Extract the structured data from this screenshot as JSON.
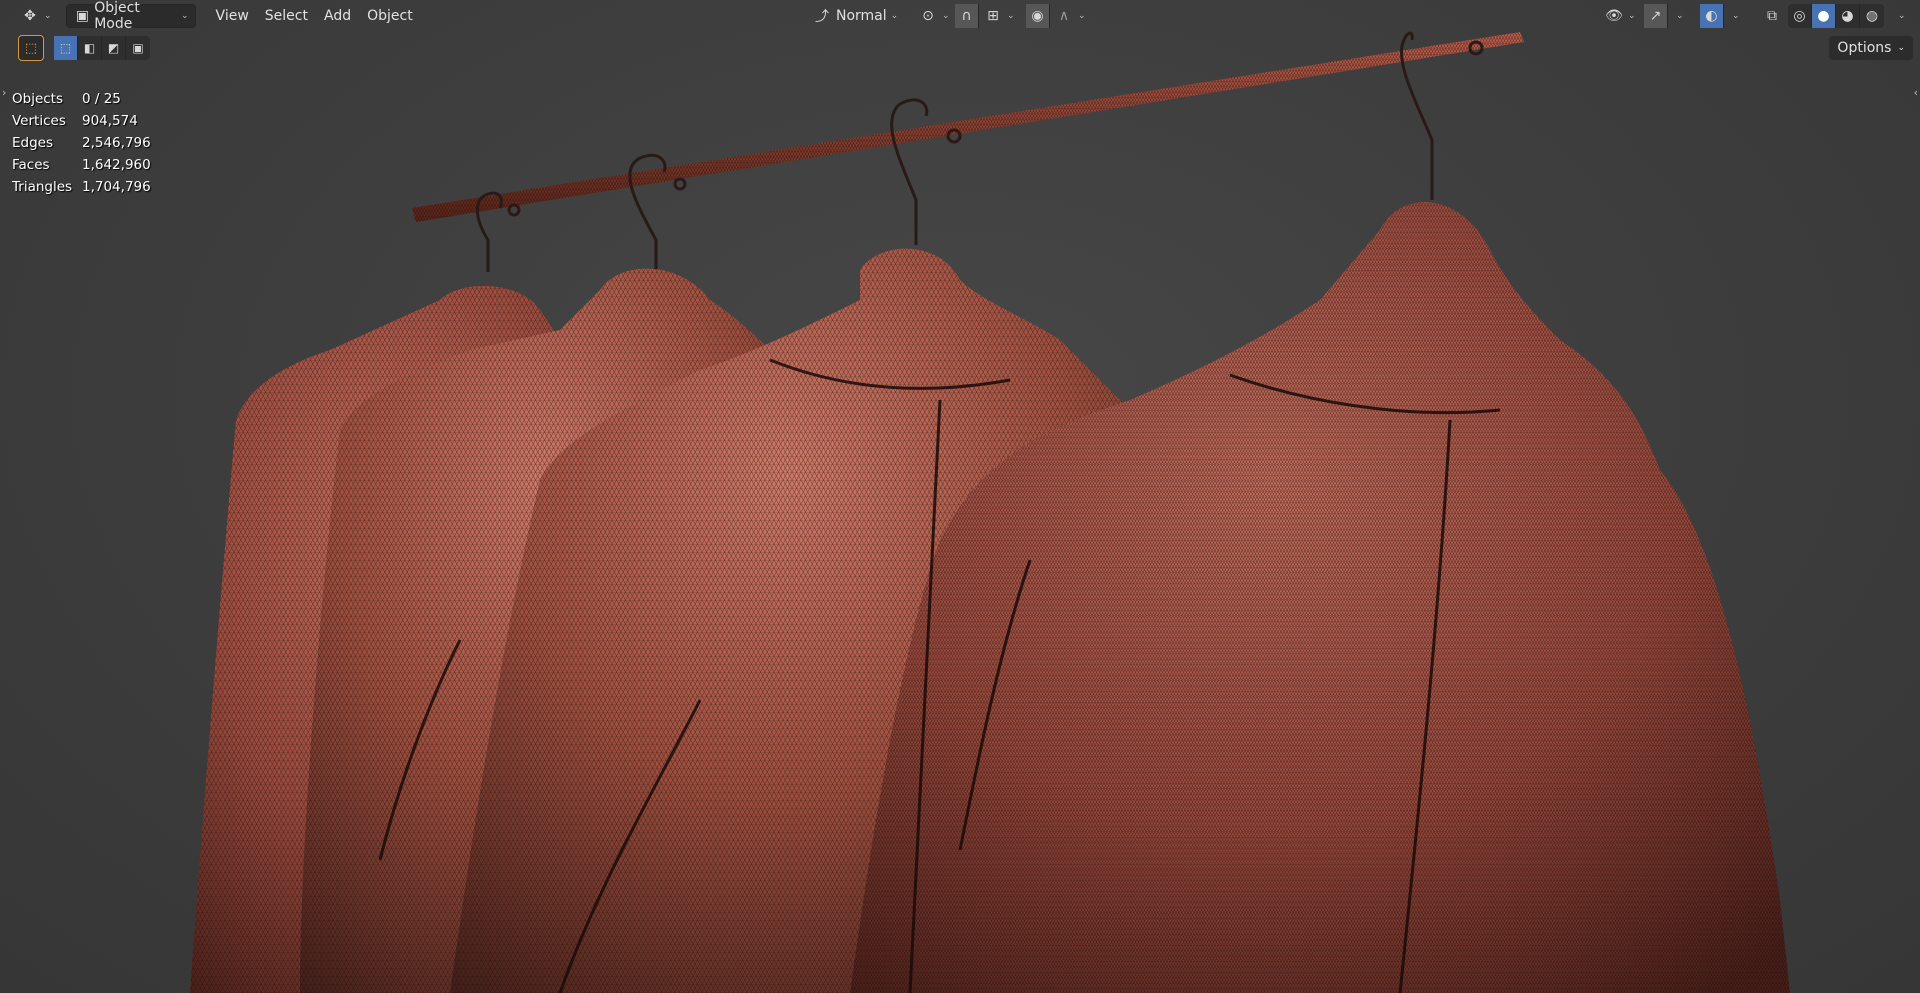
{
  "header": {
    "editor_type_icon": "move-gizmo-icon",
    "mode": "Object Mode",
    "menus": [
      "View",
      "Select",
      "Add",
      "Object"
    ],
    "transform_orientation": "Normal",
    "pivot_icon": "pivot-icon",
    "snap_icon": "magnet-icon",
    "snap_target_icon": "snap-increment-icon",
    "proportional_icon": "proportional-edit-icon",
    "falloff_icon": "falloff-curve-icon",
    "visibility_icon": "eye-icon",
    "gizmo_icon": "gizmo-icon",
    "overlay_icon": "overlay-icon",
    "xray_icon": "xray-icon",
    "shading_modes": [
      "wireframe",
      "solid",
      "material-preview",
      "rendered"
    ],
    "active_shading": "solid"
  },
  "toolbar": {
    "select_tool_icon": "select-box-icon",
    "select_modes": [
      "new",
      "extend",
      "subtract",
      "intersect"
    ],
    "options_label": "Options"
  },
  "stats": [
    {
      "label": "Objects",
      "value": "0 / 25"
    },
    {
      "label": "Vertices",
      "value": "904,574"
    },
    {
      "label": "Edges",
      "value": "2,546,796"
    },
    {
      "label": "Faces",
      "value": "1,642,960"
    },
    {
      "label": "Triangles",
      "value": "1,704,796"
    }
  ],
  "colors": {
    "viewport_bg": "#3d3d3d",
    "header_bg": "#2b2b2b",
    "accent_blue": "#4772b3",
    "mesh_fill": "#b0574a",
    "wire": "#1a0c0a"
  }
}
